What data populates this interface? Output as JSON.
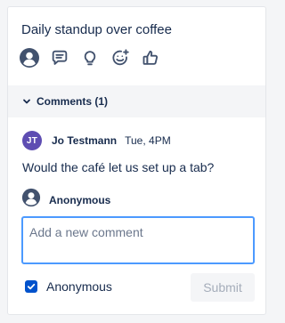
{
  "card": {
    "title": "Daily standup over coffee",
    "reactions": [
      {
        "icon": "user-avatar-icon"
      },
      {
        "icon": "comment-icon"
      },
      {
        "icon": "lightbulb-icon"
      },
      {
        "icon": "add-reaction-icon"
      },
      {
        "icon": "thumbs-up-icon"
      }
    ]
  },
  "comments": {
    "header_label": "Comments (1)",
    "items": [
      {
        "initials": "JT",
        "author": "Jo Testmann",
        "time": "Tue, 4PM",
        "body": "Would the café let us set up a tab?"
      }
    ]
  },
  "new_comment": {
    "author": "Anonymous",
    "placeholder": "Add a new comment",
    "value": "",
    "anonymous_label": "Anonymous",
    "anonymous_checked": true,
    "submit_label": "Submit",
    "submit_enabled": false
  },
  "colors": {
    "accent": "#0052cc",
    "focus_border": "#4c9aff",
    "avatar_bg": "#5e4db2",
    "icon": "#42526e",
    "text": "#172b4d"
  }
}
